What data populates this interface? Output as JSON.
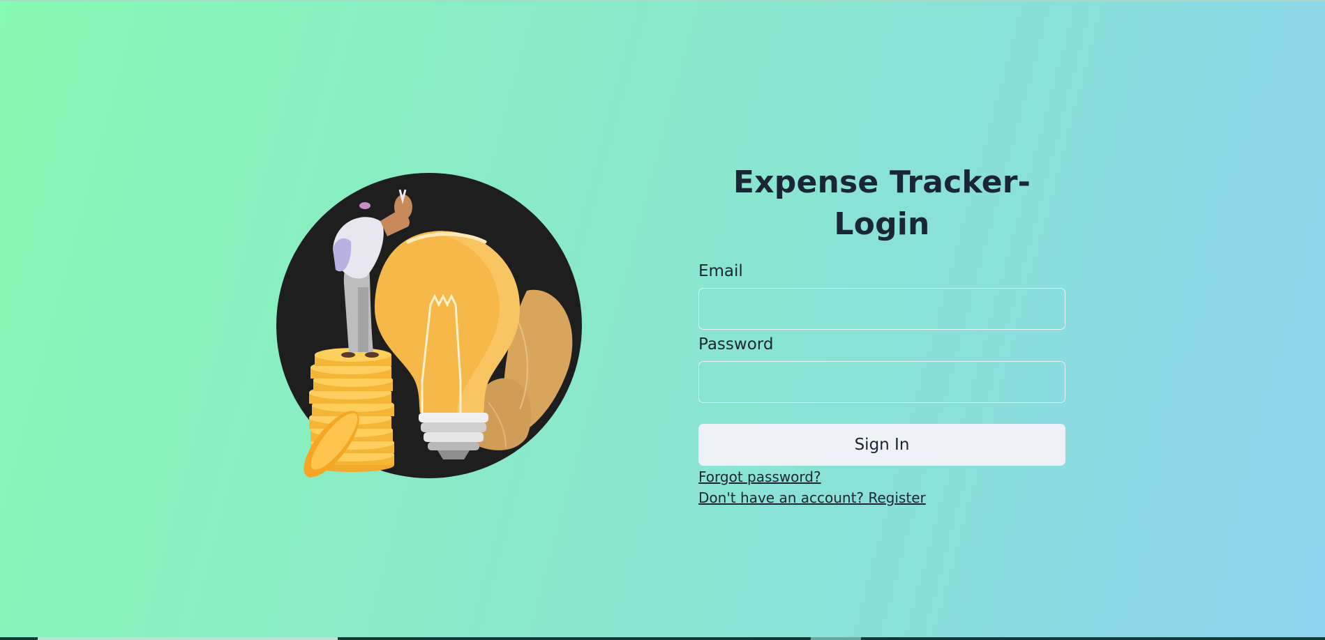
{
  "page": {
    "title": "Expense Tracker-Login"
  },
  "form": {
    "email_label": "Email",
    "email_value": "",
    "password_label": "Password",
    "password_value": "",
    "signin_label": "Sign In",
    "forgot_link": "Forgot password?",
    "register_link": "Don't have an account? Register"
  },
  "illustration": {
    "icon": "lightbulb-coins-illustration",
    "circle_color": "#1e1e1e",
    "bulb_color": "#f7b84a",
    "coin_color": "#f5b536"
  },
  "colors": {
    "gradient_start": "#86f9b2",
    "gradient_end": "#8fd4f1",
    "text": "#1a2535",
    "button_bg": "#eef2f6"
  }
}
